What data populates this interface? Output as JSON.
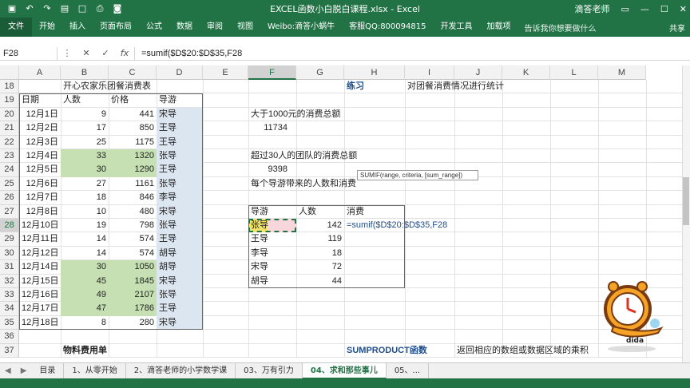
{
  "window": {
    "doc_title": "EXCEL函数小白脱白课程.xlsx  -  Excel",
    "user": "滴答老师",
    "share": "共享"
  },
  "ribbon": {
    "tabs": [
      "文件",
      "开始",
      "插入",
      "页面布局",
      "公式",
      "数据",
      "审阅",
      "视图",
      "Weibo:滴答小蜗牛",
      "客服QQ:800094815",
      "开发工具",
      "加载项"
    ],
    "tell_me": "告诉我你想要做什么"
  },
  "formula_bar": {
    "name_box": "F28",
    "cancel": "✕",
    "enter": "✓",
    "fx": "fx",
    "formula": "=sumif($D$20:$D$35,F28"
  },
  "columns": [
    "A",
    "B",
    "C",
    "D",
    "E",
    "F",
    "G",
    "H",
    "I",
    "J",
    "K",
    "L",
    "M"
  ],
  "rows": [
    "18",
    "19",
    "20",
    "21",
    "22",
    "23",
    "24",
    "25",
    "26",
    "27",
    "28",
    "29",
    "30",
    "31",
    "32",
    "33",
    "34",
    "35",
    "36",
    "37"
  ],
  "sheet": {
    "table_title": "开心农家乐团餐消费表",
    "headers": [
      "日期",
      "人数",
      "价格",
      "导游"
    ],
    "data": [
      [
        "12月1日",
        "9",
        "441",
        "宋导"
      ],
      [
        "12月2日",
        "17",
        "850",
        "王导"
      ],
      [
        "12月3日",
        "25",
        "1175",
        "王导"
      ],
      [
        "12月4日",
        "33",
        "1320",
        "张导"
      ],
      [
        "12月5日",
        "30",
        "1290",
        "王导"
      ],
      [
        "12月6日",
        "27",
        "1161",
        "张导"
      ],
      [
        "12月7日",
        "18",
        "846",
        "李导"
      ],
      [
        "12月8日",
        "10",
        "480",
        "宋导"
      ],
      [
        "12月10日",
        "19",
        "798",
        "张导"
      ],
      [
        "12月11日",
        "14",
        "574",
        "王导"
      ],
      [
        "12月12日",
        "14",
        "574",
        "胡导"
      ],
      [
        "12月14日",
        "30",
        "1050",
        "胡导"
      ],
      [
        "12月15日",
        "45",
        "1845",
        "宋导"
      ],
      [
        "12月16日",
        "49",
        "2107",
        "张导"
      ],
      [
        "12月17日",
        "47",
        "1786",
        "王导"
      ],
      [
        "12月18日",
        "8",
        "280",
        "宋导"
      ]
    ],
    "green_rows": [
      3,
      4,
      11,
      12,
      13,
      14
    ],
    "practice_title": "练习",
    "practice_desc": "对团餐消费情况进行统计",
    "q1": "大于1000元的消费总额",
    "a1": "11734",
    "q2": "超过30人的团队的消费总额",
    "a2": "9398",
    "q3": "每个导游带来的人数和消费",
    "guide_headers": [
      "导游",
      "人数",
      "消费"
    ],
    "guides": [
      [
        "张导",
        "142"
      ],
      [
        "王导",
        "119"
      ],
      [
        "李导",
        "18"
      ],
      [
        "宋导",
        "72"
      ],
      [
        "胡导",
        "44"
      ]
    ],
    "editing_formula": "=sumif($D$20:$D$35,F28",
    "tooltip": "SUMIF(range, criteria, [sum_range])",
    "material_title": "物料费用单",
    "sumproduct_title": "SUMPRODUCT函数",
    "sumproduct_desc": "返回相应的数组或数据区域的乘积"
  },
  "sheet_tabs": [
    "目录",
    "1、从零开始",
    "2、滴答老师的小学数学课",
    "03、万有引力",
    "04、求和那些事儿",
    "05、..."
  ],
  "active_tab": 4,
  "mascot_label": "dida",
  "colors": {
    "excel_green": "#217346",
    "cell_green": "#c6e0b4",
    "cell_blue": "#dce6f1"
  }
}
